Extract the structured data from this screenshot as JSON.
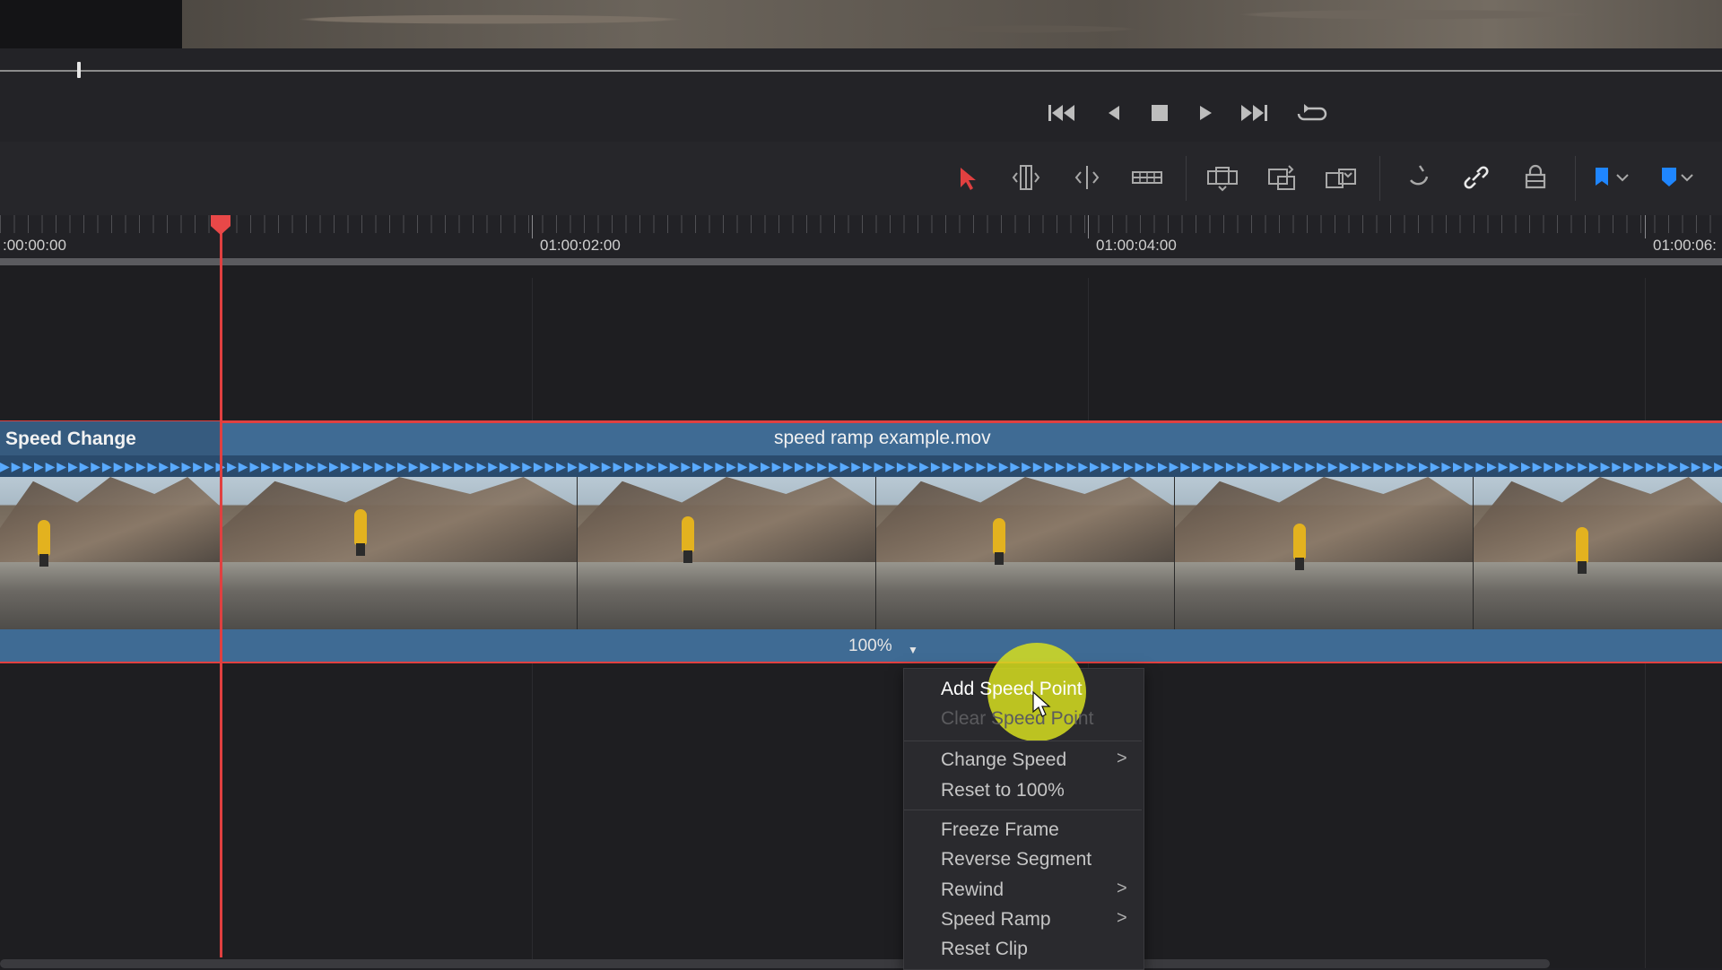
{
  "transport": {
    "icons": [
      "skip-to-start-icon",
      "step-back-icon",
      "stop-icon",
      "play-icon",
      "skip-to-end-icon",
      "loop-icon"
    ]
  },
  "toolbar": {
    "icons": [
      "selection-arrow-icon",
      "trim-edit-icon",
      "dynamic-trim-icon",
      "blade-icon",
      "insert-clip-icon",
      "overwrite-clip-icon",
      "replace-clip-icon",
      "snapping-icon",
      "linked-selection-icon",
      "position-lock-icon",
      "flag-icon",
      "marker-icon"
    ],
    "accent": "#e04040",
    "flag_color": "#1f86ff"
  },
  "ruler": {
    "labels": [
      ":00:00:00",
      "01:00:02:00",
      "01:00:04:00",
      "01:00:06:"
    ]
  },
  "clip": {
    "effect_label": "Speed Change",
    "name": "speed ramp example.mov",
    "speed": "100%",
    "color": "#3f6b94"
  },
  "context_menu": {
    "items": [
      {
        "label": "Add Speed Point",
        "enabled": true,
        "submenu": false
      },
      {
        "label": "Clear Speed Point",
        "enabled": false,
        "submenu": false
      },
      {
        "label": "Change Speed",
        "enabled": true,
        "submenu": true
      },
      {
        "label": "Reset to 100%",
        "enabled": true,
        "submenu": false
      },
      {
        "label": "Freeze Frame",
        "enabled": true,
        "submenu": false
      },
      {
        "label": "Reverse Segment",
        "enabled": true,
        "submenu": false
      },
      {
        "label": "Rewind",
        "enabled": true,
        "submenu": true
      },
      {
        "label": "Speed Ramp",
        "enabled": true,
        "submenu": true
      },
      {
        "label": "Reset Clip",
        "enabled": true,
        "submenu": false
      }
    ]
  }
}
